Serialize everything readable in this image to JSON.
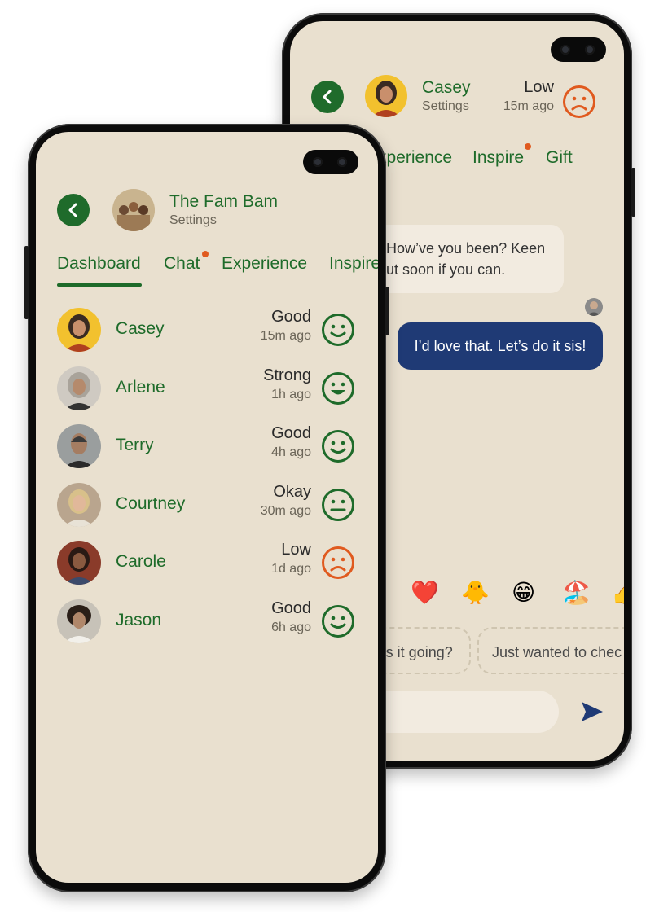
{
  "chat_phone": {
    "contact": {
      "name": "Casey",
      "subtitle": "Settings",
      "status": "Low",
      "time": "15m ago",
      "status_color": "#e05a1f"
    },
    "tabs": [
      {
        "label": "xperience",
        "notification": false
      },
      {
        "label": "Inspire",
        "notification": true
      },
      {
        "label": "Gift",
        "notification": false
      }
    ],
    "messages": [
      {
        "from": "other",
        "text_line1": "How’ve you been? Keen",
        "text_line2": "ut soon if you can."
      },
      {
        "from": "me",
        "text": "I’d love that. Let’s do it sis!"
      }
    ],
    "emojis": [
      "❤️",
      "🐥",
      "😁",
      "🏖️",
      "👍"
    ],
    "quick_replies": [
      "’s it going?",
      "Just wanted to chec"
    ],
    "send_icon": "send-icon"
  },
  "group_phone": {
    "header": {
      "title": "The Fam Bam",
      "subtitle": "Settings"
    },
    "tabs": [
      {
        "label": "Dashboard",
        "active": true,
        "notification": false
      },
      {
        "label": "Chat",
        "active": false,
        "notification": true
      },
      {
        "label": "Experience",
        "active": false,
        "notification": false
      },
      {
        "label": "Inspire",
        "active": false,
        "notification": false
      }
    ],
    "members": [
      {
        "name": "Casey",
        "status": "Good",
        "time": "15m ago",
        "mood": "smile"
      },
      {
        "name": "Arlene",
        "status": "Strong",
        "time": "1h ago",
        "mood": "grin"
      },
      {
        "name": "Terry",
        "status": "Good",
        "time": "4h ago",
        "mood": "smile"
      },
      {
        "name": "Courtney",
        "status": "Okay",
        "time": "30m ago",
        "mood": "neutral"
      },
      {
        "name": "Carole",
        "status": "Low",
        "time": "1d ago",
        "mood": "sad"
      },
      {
        "name": "Jason",
        "status": "Good",
        "time": "6h ago",
        "mood": "smile"
      }
    ]
  },
  "colors": {
    "accent_green": "#1e6b2a",
    "alert_orange": "#e05a1f",
    "screen_bg": "#e9e0cf",
    "my_bubble": "#1f3a75",
    "other_bubble": "#f2ebe0"
  }
}
